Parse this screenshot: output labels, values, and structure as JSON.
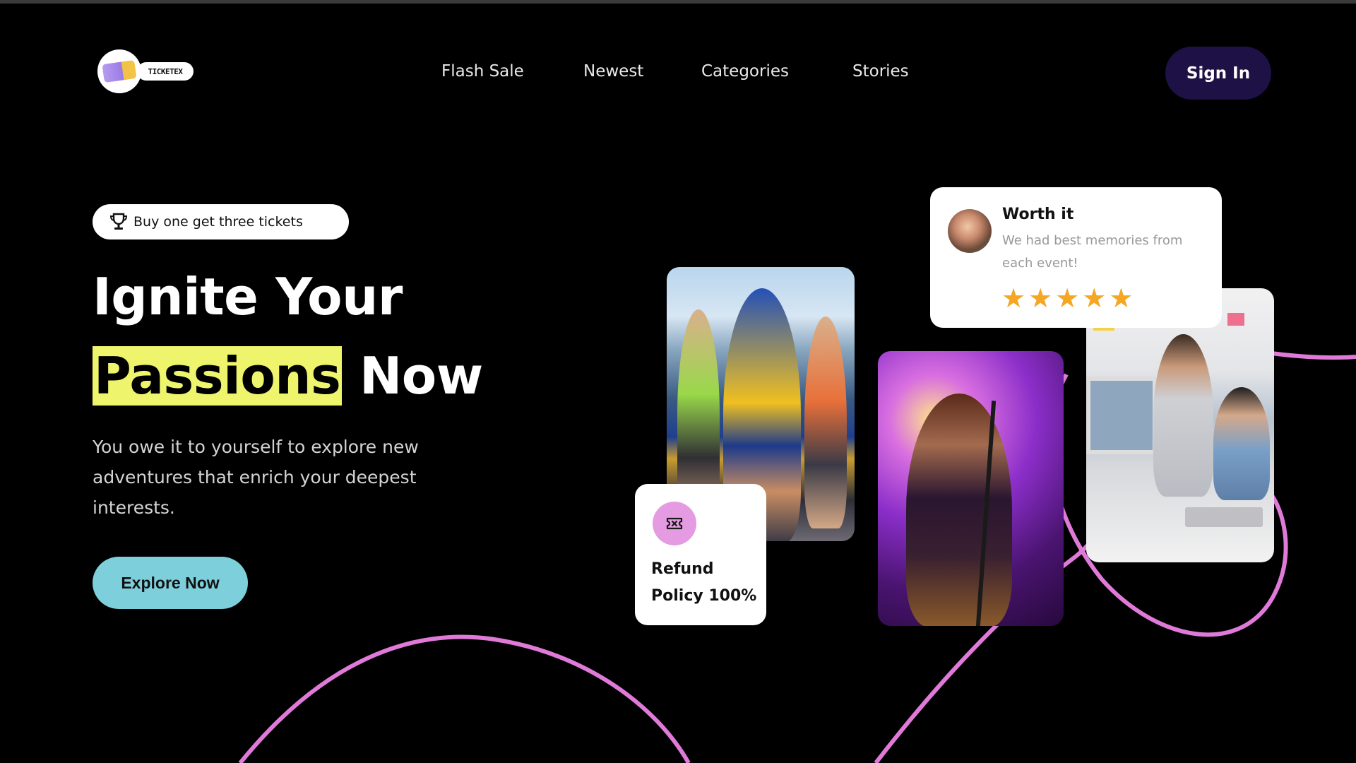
{
  "header": {
    "logo_text": "TICKETEX",
    "nav": [
      "Flash Sale",
      "Newest",
      "Categories",
      "Stories"
    ],
    "sign_in_label": "Sign In"
  },
  "hero": {
    "promo_badge": "Buy one get three tickets",
    "promo_icon": "trophy-icon",
    "headline_line1": "Ignite Your",
    "headline_highlight": "Passions",
    "headline_rest": "Now",
    "description": "You owe it to yourself to explore new adventures that enrich your deepest interests.",
    "cta_label": "Explore Now"
  },
  "review_card": {
    "title": "Worth it",
    "text": "We had best memories from each event!",
    "rating": 5,
    "rating_max": 5
  },
  "refund_card": {
    "icon": "refund-ticket-icon",
    "line1": "Refund",
    "line2": "Policy 100%"
  },
  "colors": {
    "background": "#000000",
    "accent_pink": "#e07ad8",
    "highlight_yellow": "#eef46c",
    "sign_in_bg": "#1e1145",
    "cta_bg": "#7ecfdc",
    "star": "#f5a623"
  }
}
